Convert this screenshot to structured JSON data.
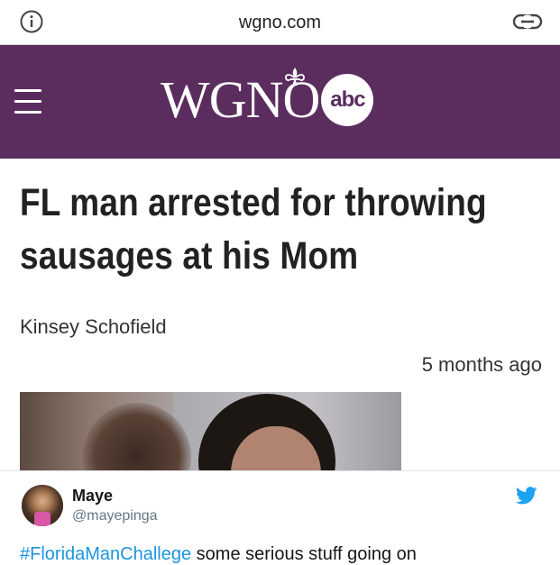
{
  "browser": {
    "domain": "wgno.com",
    "info_icon": "info-circle-icon",
    "link_icon": "link-icon"
  },
  "site": {
    "logo_text": "WGNO",
    "network_badge": "abc",
    "menu_icon": "hamburger-menu-icon",
    "brand_color": "#5b2d5f"
  },
  "article": {
    "headline": "FL man arrested for throwing sausages at his Mom",
    "author": "Kinsey Schofield",
    "timestamp": "5 months ago"
  },
  "tweet": {
    "display_name": "Maye",
    "handle": "@mayepinga",
    "hashtag": "#FloridaManChallege",
    "text": " some serious stuff going on",
    "hashtag_color": "#1b95e0",
    "twitter_icon": "twitter-bird-icon"
  }
}
